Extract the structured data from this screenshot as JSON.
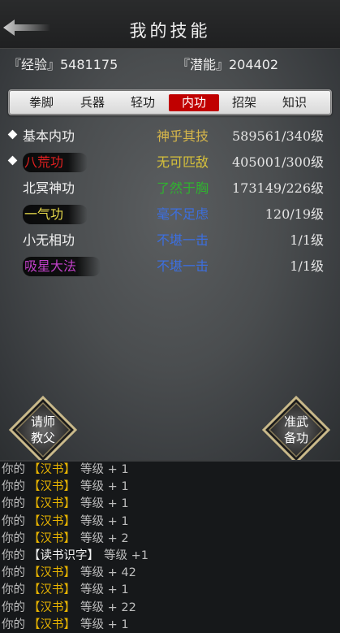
{
  "header": {
    "title": "我的技能"
  },
  "stats": {
    "exp": "『经验』5481175",
    "potential": "『潜能』204402"
  },
  "tabs": [
    {
      "label": "拳脚",
      "active": false
    },
    {
      "label": "兵器",
      "active": false
    },
    {
      "label": "轻功",
      "active": false
    },
    {
      "label": "内功",
      "active": true
    },
    {
      "label": "招架",
      "active": false
    },
    {
      "label": "知识",
      "active": false
    }
  ],
  "skills": [
    {
      "name": "基本内功",
      "rank": "神乎其技",
      "level": "589561/340级",
      "marked": true,
      "name_color": "#f2f2f2",
      "rank_color": "#d6b64a"
    },
    {
      "name": "八荒功",
      "rank": "无可匹敌",
      "level": "405001/300级",
      "marked": true,
      "name_color": "#e02020",
      "rank_color": "#d8c23a"
    },
    {
      "name": "北冥神功",
      "rank": "了然于胸",
      "level": "173149/226级",
      "marked": false,
      "name_color": "#f2f2f2",
      "rank_color": "#2fb32f"
    },
    {
      "name": "一气功",
      "rank": "毫不足虑",
      "level": "120/19级",
      "marked": false,
      "name_color": "#e6d84a",
      "rank_color": "#3c6fe0"
    },
    {
      "name": "小无相功",
      "rank": "不堪一击",
      "level": "1/1级",
      "marked": false,
      "name_color": "#f2f2f2",
      "rank_color": "#3c6fe0"
    },
    {
      "name": "吸星大法",
      "rank": "不堪一击",
      "level": "1/1级",
      "marked": false,
      "name_color": "#c040c8",
      "rank_color": "#3c6fe0"
    }
  ],
  "buttons": {
    "ask_master": "请师教父",
    "prepare": "准武备功"
  },
  "log": [
    {
      "prefix": "你的",
      "book": "【汉书】",
      "suffix": "等级 + 1",
      "book_color": "yellow"
    },
    {
      "prefix": "你的",
      "book": "【汉书】",
      "suffix": "等级 + 1",
      "book_color": "yellow"
    },
    {
      "prefix": "你的",
      "book": "【汉书】",
      "suffix": "等级 + 1",
      "book_color": "yellow"
    },
    {
      "prefix": "你的",
      "book": "【汉书】",
      "suffix": "等级 + 1",
      "book_color": "yellow"
    },
    {
      "prefix": "你的",
      "book": "【汉书】",
      "suffix": "等级 + 2",
      "book_color": "yellow"
    },
    {
      "prefix": "你的",
      "book": "【读书识字】",
      "suffix": "等级 +1",
      "book_color": "white"
    },
    {
      "prefix": "你的",
      "book": "【汉书】",
      "suffix": "等级 + 42",
      "book_color": "yellow"
    },
    {
      "prefix": "你的",
      "book": "【汉书】",
      "suffix": "等级 + 1",
      "book_color": "yellow"
    },
    {
      "prefix": "你的",
      "book": "【汉书】",
      "suffix": "等级 + 22",
      "book_color": "yellow"
    },
    {
      "prefix": "你的",
      "book": "【汉书】",
      "suffix": "等级 + 1",
      "book_color": "yellow"
    }
  ]
}
